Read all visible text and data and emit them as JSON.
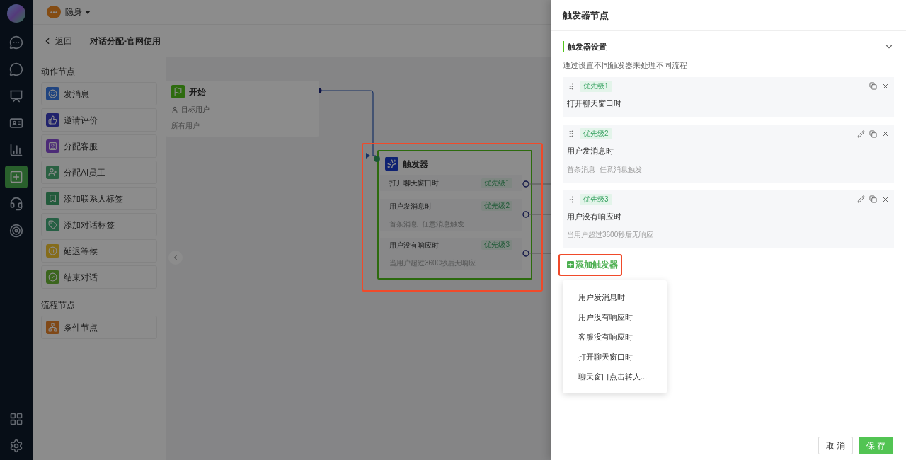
{
  "rail": {
    "items": [
      {
        "kind": "logo",
        "selected": false
      },
      {
        "kind": "chat",
        "selected": false
      },
      {
        "kind": "history",
        "selected": false
      },
      {
        "kind": "board",
        "selected": false
      },
      {
        "kind": "contact",
        "selected": false
      },
      {
        "kind": "chart",
        "selected": false
      },
      {
        "kind": "flow",
        "selected": true
      },
      {
        "kind": "ai",
        "selected": false
      },
      {
        "kind": "target",
        "selected": false
      }
    ],
    "bottom": [
      {
        "kind": "apps"
      },
      {
        "kind": "settings"
      }
    ]
  },
  "topbar": {
    "status": "隐身"
  },
  "header": {
    "back": "返回",
    "title": "对话分配-官网使用"
  },
  "palette": {
    "sections": [
      {
        "title": "动作节点",
        "items": [
          {
            "kind": "message",
            "label": "发消息",
            "color": "#204480"
          },
          {
            "kind": "thumb",
            "label": "邀请评价",
            "color": "#20226c"
          },
          {
            "kind": "agent",
            "label": "分配客服",
            "color": "#4c2b77"
          },
          {
            "kind": "ai-agent",
            "label": "分配AI员工",
            "color": "#2a6042"
          },
          {
            "kind": "bookmark",
            "label": "添加联系人标签",
            "color": "#225a3b"
          },
          {
            "kind": "tag",
            "label": "添加对话标签",
            "color": "#265f44"
          },
          {
            "kind": "pause",
            "label": "延迟等候",
            "color": "#856c1b"
          },
          {
            "kind": "check",
            "label": "结束对话",
            "color": "#3b651d"
          }
        ]
      },
      {
        "title": "流程节点",
        "items": [
          {
            "kind": "branch",
            "label": "条件节点",
            "color": "#804918"
          }
        ]
      }
    ]
  },
  "canvas": {
    "start_node": {
      "title": "开始",
      "field_label": "目标用户",
      "field_value": "所有用户"
    },
    "trigger_node": {
      "title": "触发器",
      "triggers": [
        {
          "label": "打开聊天窗口时",
          "priority": "优先级1"
        },
        {
          "label": "用户发消息时",
          "priority": "优先级2",
          "detail": "首条消息  任意消息触发"
        },
        {
          "label": "用户没有响应时",
          "priority": "优先级3",
          "detail": "当用户超过3600秒后无响应"
        }
      ]
    }
  },
  "drawer": {
    "title": "触发器节点",
    "section": {
      "title": "触发器设置",
      "expanded": true,
      "description": "通过设置不同触发器来处理不同流程"
    },
    "triggers": [
      {
        "priority": "优先级1",
        "label": "打开聊天窗口时",
        "editable": false
      },
      {
        "priority": "优先级2",
        "label": "用户发消息时",
        "editable": true,
        "details": [
          "首条消息",
          "任意消息触发"
        ]
      },
      {
        "priority": "优先级3",
        "label": "用户没有响应时",
        "editable": true,
        "details": [
          "当用户超过3600秒后无响应"
        ]
      }
    ],
    "add_button": "添加触发器",
    "menu": [
      "用户发消息时",
      "用户没有响应时",
      "客服没有响应时",
      "打开聊天窗口时",
      "聊天窗口点击转人..."
    ],
    "buttons": {
      "cancel": "取 消",
      "save": "保 存"
    }
  }
}
